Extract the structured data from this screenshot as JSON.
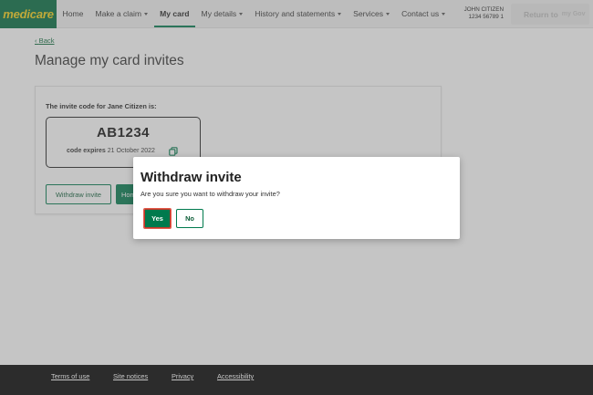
{
  "header": {
    "logo": "medicare",
    "nav": [
      {
        "label": "Home",
        "dropdown": false,
        "active": false
      },
      {
        "label": "Make a claim",
        "dropdown": true,
        "active": false
      },
      {
        "label": "My card",
        "dropdown": false,
        "active": true
      },
      {
        "label": "My details",
        "dropdown": true,
        "active": false
      },
      {
        "label": "History and statements",
        "dropdown": true,
        "active": false
      },
      {
        "label": "Services",
        "dropdown": true,
        "active": false
      },
      {
        "label": "Contact us",
        "dropdown": true,
        "active": false
      }
    ],
    "user_name": "JOHN CITIZEN",
    "user_number": "1234 56789 1",
    "return_label": "Return to",
    "return_brand": "my Gov"
  },
  "back_label": "Back",
  "page_title": "Manage my card invites",
  "invite_card": {
    "label": "The invite code for Jane Citizen is:",
    "code": "AB1234",
    "expiry_label": "code expires",
    "expiry_date": "21 October 2022",
    "withdraw_label": "Withdraw invite",
    "home_label": "Hon"
  },
  "modal": {
    "title": "Withdraw invite",
    "text": "Are you sure you want to withdraw your invite?",
    "yes_label": "Yes",
    "no_label": "No"
  },
  "footer": {
    "links": [
      "Terms of use",
      "Site notices",
      "Privacy",
      "Accessibility"
    ]
  },
  "colors": {
    "brand_green": "#007a4d",
    "logo_yellow": "#f7d117",
    "focus_red": "#c0392b"
  }
}
